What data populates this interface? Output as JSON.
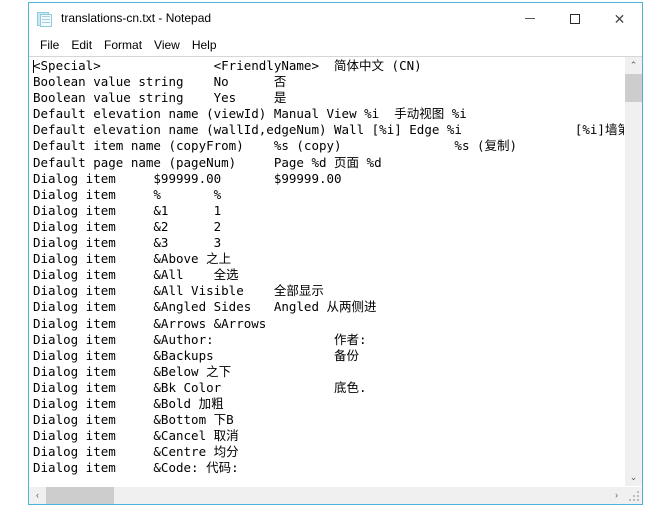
{
  "window": {
    "title": "translations-cn.txt - Notepad",
    "icon": "notepad-icon",
    "border_color": "#4fb3d9",
    "controls": {
      "minimize": "—",
      "maximize": "☐",
      "close": "✕"
    }
  },
  "menubar": {
    "items": [
      {
        "label": "File"
      },
      {
        "label": "Edit"
      },
      {
        "label": "Format"
      },
      {
        "label": "View"
      },
      {
        "label": "Help"
      }
    ]
  },
  "editor": {
    "lines": [
      "<Special>\t\t<FriendlyName>\t简体中文 (CN)",
      "Boolean value string\tNo\t否",
      "Boolean value string\tYes\t是",
      "Default elevation name (viewId) Manual View %i\t手动视图 %i",
      "Default elevation name (wallId,edgeNum) Wall [%i] Edge %i\t\t[%i]墙第%i面",
      "Default item name (copyFrom)\t%s (copy)\t\t%s (复制)",
      "Default page name (pageNum)\tPage %d 页面 %d",
      "Dialog item\t$99999.00\t$99999.00",
      "Dialog item\t%\t%",
      "Dialog item\t&1\t1",
      "Dialog item\t&2\t2",
      "Dialog item\t&3\t3",
      "Dialog item\t&Above 之上",
      "Dialog item\t&All\t全选",
      "Dialog item\t&All Visible\t全部显示",
      "Dialog item\t&Angled Sides\tAngled 从两侧进",
      "Dialog item\t&Arrows &Arrows",
      "Dialog item\t&Author:\t\t作者:",
      "Dialog item\t&Backups\t\t备份",
      "Dialog item\t&Below 之下",
      "Dialog item\t&Bk Color\t\t底色.",
      "Dialog item\t&Bold 加粗",
      "Dialog item\t&Bottom 下B",
      "Dialog item\t&Cancel 取消",
      "Dialog item\t&Centre 均分",
      "Dialog item\t&Code: 代码:"
    ]
  },
  "scrollbars": {
    "vertical": {
      "up_arrow": "⌃",
      "down_arrow": "⌄",
      "thumb_position_percent": 0,
      "thumb_size_percent": 6
    },
    "horizontal": {
      "left_arrow": "‹",
      "right_arrow": "›",
      "thumb_position_percent": 0,
      "thumb_size_percent": 12
    }
  }
}
